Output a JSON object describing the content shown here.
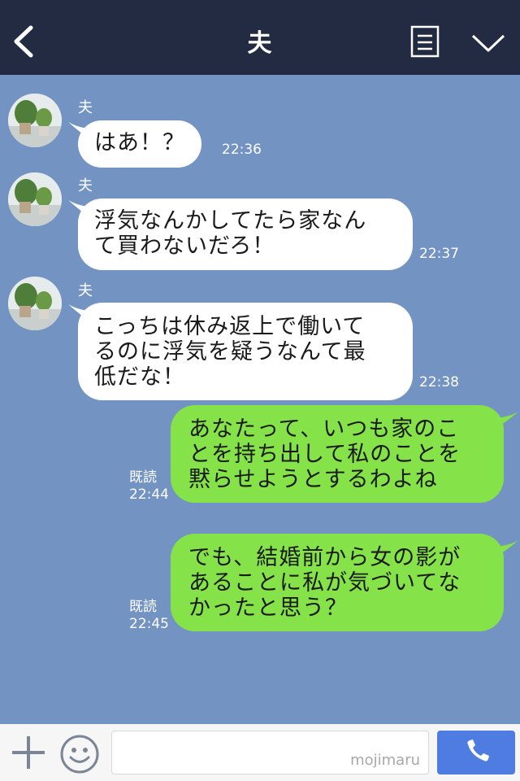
{
  "header": {
    "title": "夫",
    "back_icon": "chevron-left-icon",
    "note_icon": "note-icon",
    "menu_icon": "chevron-down-icon",
    "background": "#222b41"
  },
  "chat": {
    "background": "#7393c2",
    "incoming_bubble_color": "#ffffff",
    "outgoing_bubble_color": "#85e249",
    "messages": [
      {
        "direction": "incoming",
        "sender": "夫",
        "text": "はあ！？",
        "time": "22:36"
      },
      {
        "direction": "incoming",
        "sender": "夫",
        "text": "浮気なんかしてたら家なん\nて買わないだろ！",
        "time": "22:37"
      },
      {
        "direction": "incoming",
        "sender": "夫",
        "text": "こっちは休み返上で働いて\nるのに浮気を疑うなんて最\n低だな！",
        "time": "22:38"
      },
      {
        "direction": "outgoing",
        "read": "既読",
        "text": "あなたって、いつも家のこ\nとを持ち出して私のことを\n黙らせようとするわよね",
        "time": "22:44"
      },
      {
        "direction": "outgoing",
        "read": "既読",
        "text": "でも、結婚前から女の影が\nあることに私が気づいてな\nかったと思う？",
        "time": "22:45"
      }
    ]
  },
  "input_bar": {
    "plus_icon": "plus-icon",
    "emoji_icon": "smiley-icon",
    "input_value": "",
    "watermark": "mojimaru",
    "call_icon": "phone-icon",
    "call_button_color": "#4e7ce0"
  }
}
